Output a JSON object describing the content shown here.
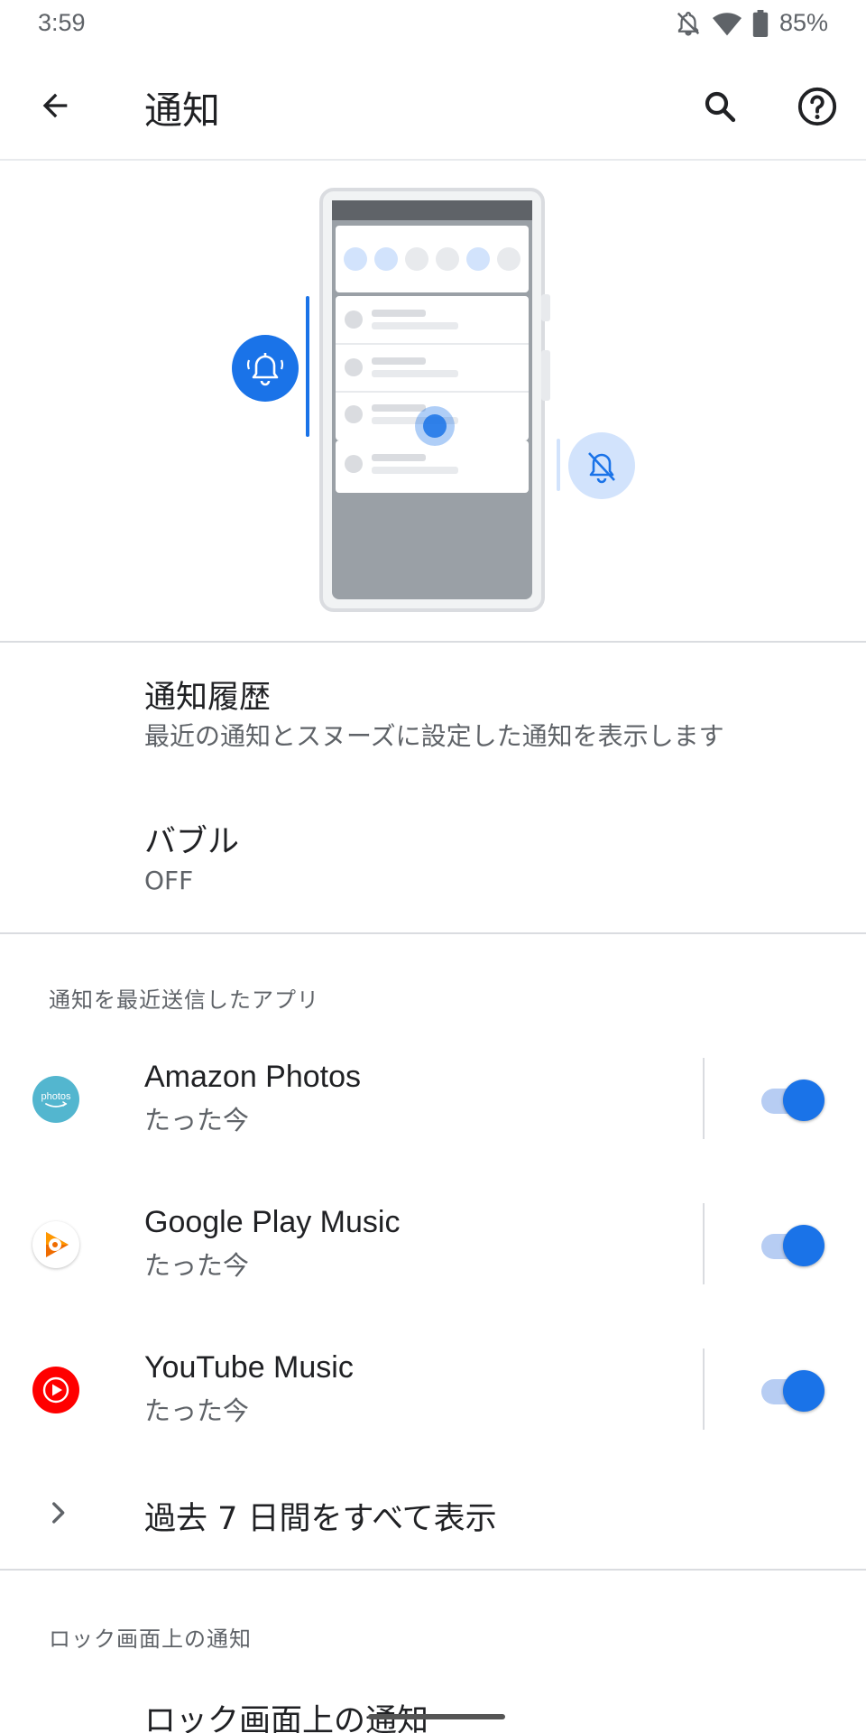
{
  "status_bar": {
    "time": "3:59",
    "battery": "85%",
    "icons": [
      "bell-off-icon",
      "wifi-icon",
      "battery-icon"
    ]
  },
  "app_bar": {
    "title": "通知",
    "icons": [
      "back-arrow-icon",
      "search-icon",
      "help-icon"
    ]
  },
  "preferences": {
    "history": {
      "title": "通知履歴",
      "summary": "最近の通知とスヌーズに設定した通知を表示します"
    },
    "bubbles": {
      "title": "バブル",
      "summary": "OFF"
    }
  },
  "recent_apps": {
    "header": "通知を最近送信したアプリ",
    "apps": [
      {
        "name": "Amazon Photos",
        "time": "たった今",
        "icon": "amazon-photos-icon",
        "icon_text": "photos",
        "enabled": true
      },
      {
        "name": "Google Play Music",
        "time": "たった今",
        "icon": "google-play-music-icon",
        "enabled": true
      },
      {
        "name": "YouTube Music",
        "time": "たった今",
        "icon": "youtube-music-icon",
        "enabled": true
      }
    ],
    "see_all": "過去 7 日間をすべて表示"
  },
  "lock_screen": {
    "header": "ロック画面上の通知",
    "item": "ロック画面上の通知"
  },
  "colors": {
    "accent": "#1a73e8",
    "toggle_track": "#b7cdf3",
    "divider": "#dadce0",
    "secondary_text": "#5f6368"
  }
}
